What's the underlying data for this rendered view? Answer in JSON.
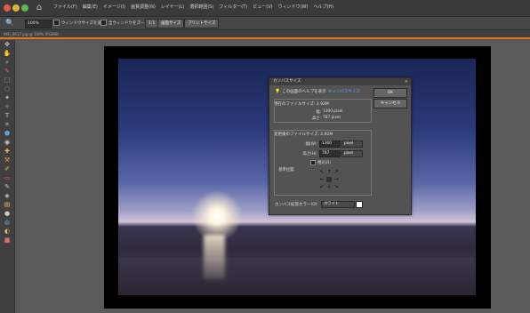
{
  "menubar": {
    "items": [
      "ファイル(F)",
      "編集(E)",
      "イメージ(I)",
      "画質調整(N)",
      "レイヤー(L)",
      "選択範囲(S)",
      "フィルター(T)",
      "ビュー(V)",
      "ウィンドウ(W)",
      "ヘルプ(H)"
    ],
    "window_buttons": [
      "#e05a4a",
      "#e0b03a",
      "#62b356"
    ]
  },
  "options": {
    "zoom": "100%",
    "resize_windows_label": "ウィンドウサイズを変更",
    "all_windows_label": "全ウィンドウをズーム",
    "ratio": "1:1",
    "fit_screen_label": "画面サイズ",
    "print_size_label": "プリントサイズ"
  },
  "document": {
    "tab_title": "IMG_0617.jpg @ 100% (RGB/8)"
  },
  "dialog": {
    "title": "カンバスサイズ",
    "help_text": "この画面のヘルプを表示",
    "help_link": "キャンバスサイズ",
    "ok_label": "OK",
    "cancel_label": "キャンセル",
    "current_legend": "現在のファイルサイズ: 2.92M",
    "current_width_label": "幅:",
    "current_width_value": "1300 pixel",
    "current_height_label": "高さ:",
    "current_height_value": "787 pixel",
    "new_legend": "変更後のファイルサイズ: 2.92M",
    "new_width_label": "幅(W):",
    "new_width_value": "1300",
    "new_height_label": "高さ(H):",
    "new_height_value": "787",
    "unit": "pixel",
    "relative_label": "相対(R)",
    "anchor_label": "基準位置:",
    "extension_label": "カンバス拡張カラー(O):",
    "extension_value": "ホワイト",
    "extension_swatch_color": "#ffffff"
  },
  "accent_color": "#e07b1b"
}
